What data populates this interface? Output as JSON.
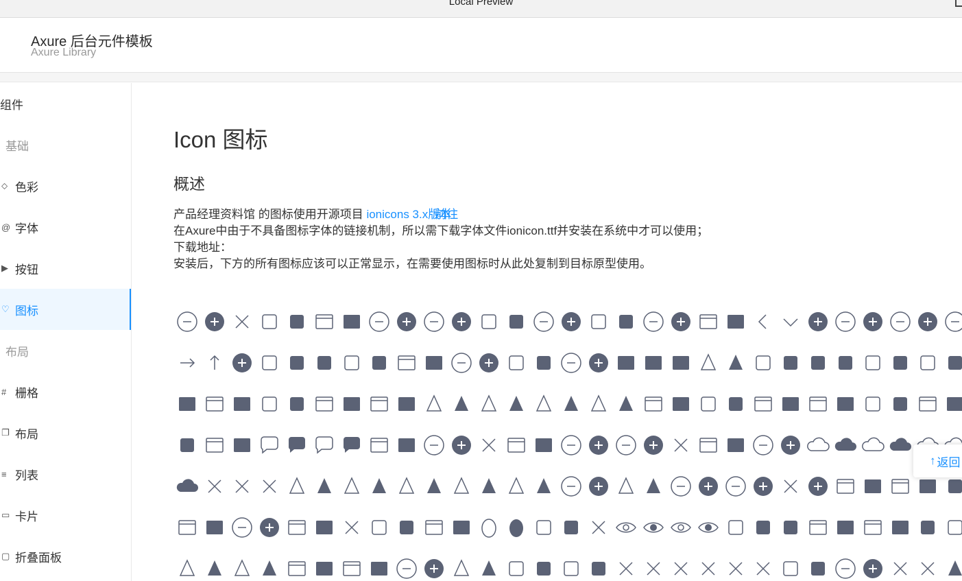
{
  "window": {
    "title": "Local Preview"
  },
  "header": {
    "brand": "Axure 后台元件模板",
    "subtitle": "Axure Library"
  },
  "sidebar": {
    "items": [
      {
        "label": "组件",
        "kind": "group-root",
        "icon": ""
      },
      {
        "label": "基础",
        "kind": "group",
        "icon": ""
      },
      {
        "label": "色彩",
        "kind": "item",
        "icon": "paint-bucket-icon"
      },
      {
        "label": "字体",
        "kind": "item",
        "icon": "at-icon"
      },
      {
        "label": "按钮",
        "kind": "item",
        "icon": "play-button-icon"
      },
      {
        "label": "图标",
        "kind": "item",
        "icon": "heart-icon",
        "active": true
      },
      {
        "label": "布局",
        "kind": "group",
        "icon": ""
      },
      {
        "label": "栅格",
        "kind": "item",
        "icon": "grid-icon"
      },
      {
        "label": "布局",
        "kind": "item",
        "icon": "copy-icon"
      },
      {
        "label": "列表",
        "kind": "item",
        "icon": "list-icon"
      },
      {
        "label": "卡片",
        "kind": "item",
        "icon": "card-icon"
      },
      {
        "label": "折叠面板",
        "kind": "item",
        "icon": "panel-icon"
      }
    ]
  },
  "main": {
    "title": "Icon 图标",
    "section": "概述",
    "para_prefix": "产品经理资料馆 的图标使用开源项目 ",
    "link1": "ionicons 3.x版本",
    "link2": "前往",
    "line2": "在Axure中由于不具备图标字体的链接机制，所以需下载字体文件ionicon.ttf并安装在系统中才可以使用；",
    "line3": "下载地址：",
    "line4": "安装后，下方的所有图标应该可以正常显示，在需要使用图标时从此处复制到目标原型使用。"
  },
  "back_to_top": {
    "label": "返回"
  },
  "colors": {
    "icon": "#5b6275",
    "accent": "#1890ff"
  },
  "icon_rows": [
    [
      "add-circle-outline-icon",
      "add-circle-icon",
      "add-icon",
      "alarm-outline-icon",
      "alarm-icon",
      "albums-outline-icon",
      "albums-icon",
      "alert-circle-outline-icon",
      "alert-circle-icon",
      "american-football-outline-icon",
      "american-football-icon",
      "analytics-outline-icon",
      "analytics-icon",
      "aperture-outline-icon",
      "aperture-icon",
      "apps-outline-icon",
      "apps-icon",
      "appstore-outline-icon",
      "appstore-icon",
      "archive-outline-icon",
      "archive-icon",
      "arrow-back-icon",
      "arrow-down-icon",
      "arrow-dropdown-circle-icon",
      "arrow-dropdown-circle-outline-icon",
      "arrow-dropleft-circle-icon",
      "arrow-dropleft-circle-outline-icon",
      "arrow-dropright-circle-icon",
      "arrow-dropright-circle-outline-icon"
    ],
    [
      "arrow-forward-icon",
      "arrow-up-icon",
      "arrow-dropup-icon",
      "at-outline-icon",
      "at-icon",
      "attach-icon",
      "backspace-outline-icon",
      "backspace-icon",
      "barcode-outline-icon",
      "barcode-icon",
      "baseball-outline-icon",
      "baseball-icon",
      "basket-outline-icon",
      "basket-icon",
      "basketball-outline-icon",
      "basketball-icon",
      "battery-charging-icon",
      "battery-dead-icon",
      "battery-full-icon",
      "beaker-outline-icon",
      "beaker-icon",
      "beer-outline-icon",
      "beer-icon",
      "bicycle-icon",
      "bluetooth-icon",
      "boat-outline-icon",
      "boat-icon",
      "body-outline-icon",
      "body-icon"
    ],
    [
      "bookmark-icon",
      "book-outline-icon",
      "book-icon",
      "bowtie-outline-icon",
      "bowtie-icon",
      "briefcase-outline-icon",
      "briefcase-icon",
      "browsers-outline-icon",
      "browsers-icon",
      "brush-outline-icon",
      "brush-icon",
      "bug-outline-icon",
      "bug-icon",
      "build-outline-icon",
      "build-icon",
      "bulb-outline-icon",
      "bulb-icon",
      "bus-outline-icon",
      "bus-icon",
      "cafe-outline-icon",
      "cafe-icon",
      "calculator-outline-icon",
      "calculator-icon",
      "calendar-outline-icon",
      "calendar-icon",
      "call-outline-icon",
      "call-icon",
      "camera-outline-icon",
      "camera-icon"
    ],
    [
      "cart-icon",
      "cash-outline-icon",
      "cash-icon",
      "chatboxes-outline-icon",
      "chatboxes-icon",
      "chatbubbles-outline-icon",
      "chatbubbles-icon",
      "checkbox-outline-icon",
      "checkbox-icon",
      "checkmark-circle-outline-icon",
      "checkmark-circle-icon",
      "checkmark-icon",
      "clipboard-outline-icon",
      "clipboard-icon",
      "clock-outline-icon",
      "clock-icon",
      "close-circle-outline-icon",
      "close-circle-icon",
      "close-icon",
      "closed-captioning-outline-icon",
      "closed-captioning-icon",
      "cloud-circle-outline-icon",
      "cloud-circle-icon",
      "cloud-done-outline-icon",
      "cloud-done-icon",
      "cloud-download-outline-icon",
      "cloud-download-icon",
      "cloud-outline-icon",
      "cloud-upload-outline-icon"
    ],
    [
      "cloud-icon",
      "code-working-icon",
      "code-download-icon",
      "code-icon",
      "cog-outline-icon",
      "cog-icon",
      "color-fill-outline-icon",
      "color-fill-icon",
      "color-filter-outline-icon",
      "color-filter-icon",
      "color-palette-outline-icon",
      "color-palette-icon",
      "color-wand-outline-icon",
      "color-wand-icon",
      "compass-outline-icon",
      "compass-icon",
      "construct-outline-icon",
      "construct-icon",
      "contact-outline-icon",
      "contact-icon",
      "contacts-outline-icon",
      "contacts-icon",
      "contract-icon",
      "contrast-icon",
      "copy-outline-icon",
      "copy-icon",
      "create-outline-icon",
      "create-icon",
      "crop-icon"
    ],
    [
      "desktop-outline-icon",
      "desktop-icon",
      "disc-outline-icon",
      "disc-icon",
      "document-outline-icon",
      "document-icon",
      "done-all-icon",
      "download-outline-icon",
      "download-icon",
      "easel-outline-icon",
      "easel-icon",
      "egg-outline-icon",
      "egg-icon",
      "exit-outline-icon",
      "exit-icon",
      "expand-icon",
      "eye-off-outline-icon",
      "eye-off-icon",
      "eye-outline-icon",
      "eye-icon",
      "fastforward-outline-icon",
      "fastforward-icon",
      "female-icon",
      "filing-outline-icon",
      "filing-icon",
      "film-outline-icon",
      "film-icon",
      "finger-print-icon",
      "flag-outline-icon"
    ],
    [
      "flask-outline-icon",
      "flask-icon",
      "flower-outline-icon",
      "flower-icon",
      "folder-outline-icon",
      "folder-icon",
      "folder-open-outline-icon",
      "folder-open-icon",
      "football-outline-icon",
      "football-icon",
      "funnel-outline-icon",
      "funnel-icon",
      "game-controller-a-outline-icon",
      "game-controller-a-icon",
      "game-controller-b-outline-icon",
      "game-controller-b-icon",
      "git-branch-icon",
      "git-commit-icon",
      "git-compare-icon",
      "git-merge-icon",
      "git-network-icon",
      "git-pull-request-icon",
      "glasses-outline-icon",
      "glasses-icon",
      "globe-outline-icon",
      "globe-icon",
      "grid-outline-icon",
      "grid-icon",
      "hammer-icon"
    ]
  ]
}
